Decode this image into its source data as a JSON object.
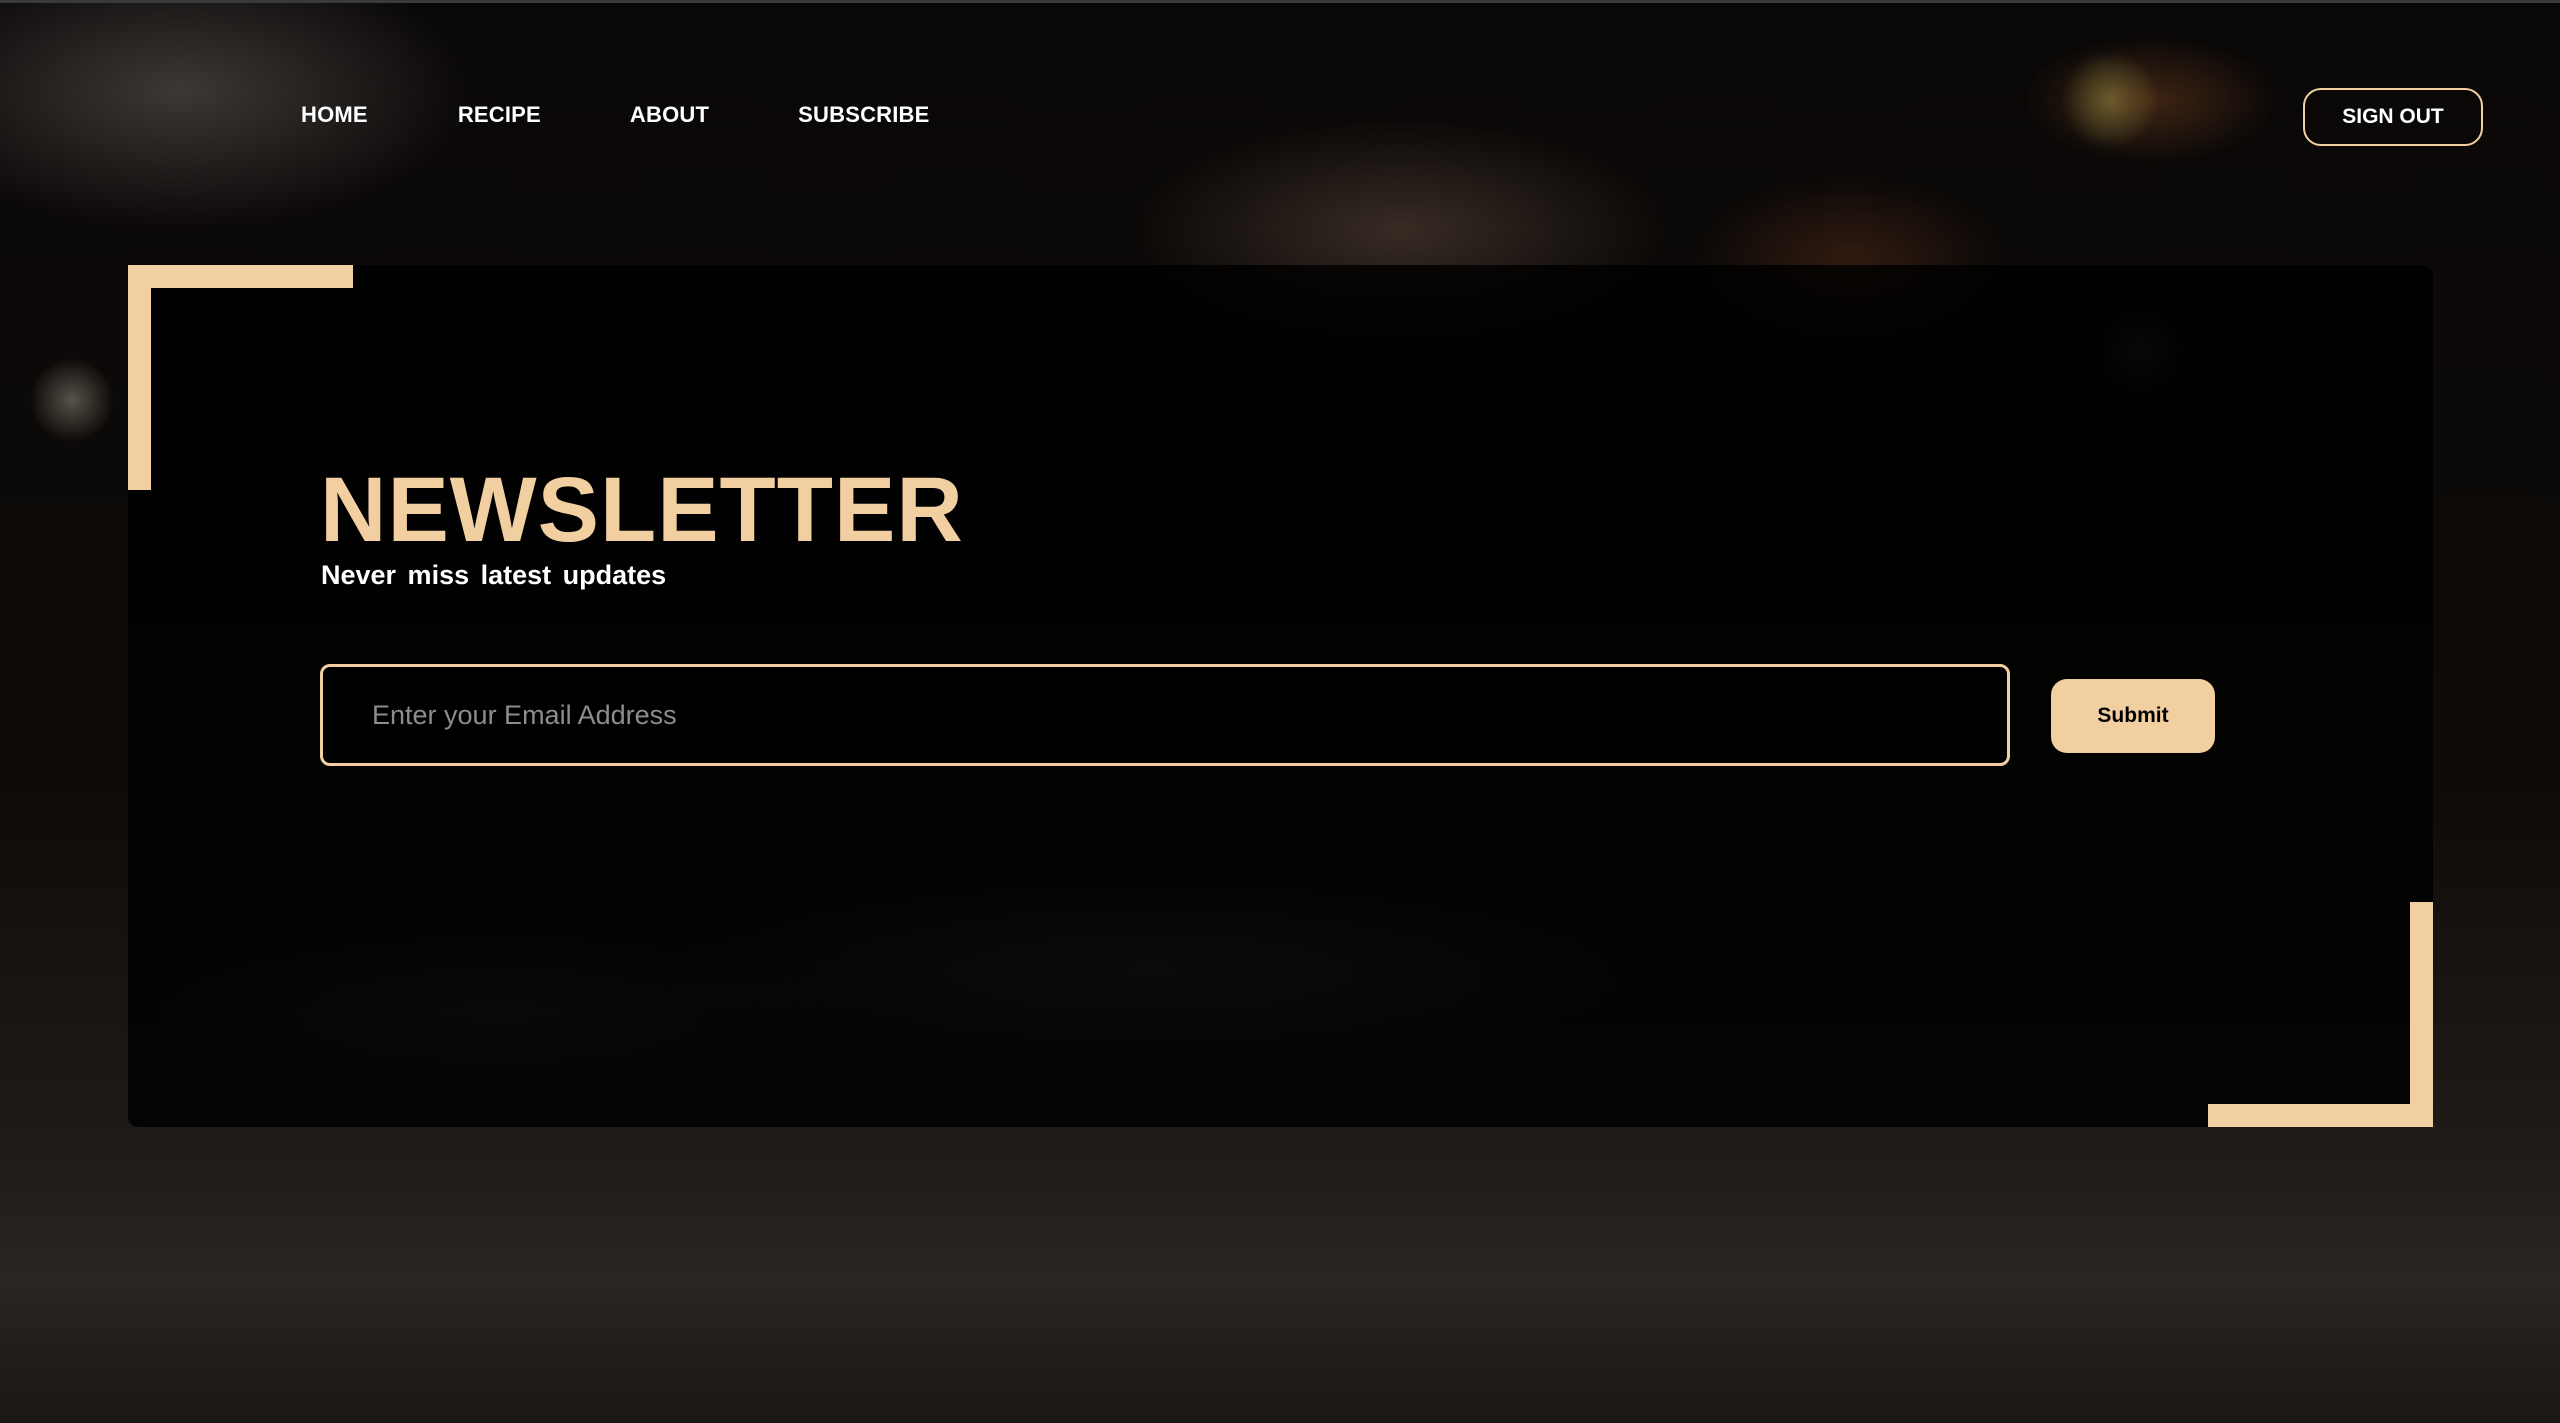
{
  "nav": {
    "items": [
      {
        "label": "HOME"
      },
      {
        "label": "RECIPE"
      },
      {
        "label": "ABOUT"
      },
      {
        "label": "SUBSCRIBE"
      }
    ],
    "signout_label": "SIGN OUT"
  },
  "newsletter": {
    "title": "NEWSLETTER",
    "subtitle": "Never miss latest updates",
    "email_placeholder": "Enter your Email Address",
    "email_value": "",
    "submit_label": "Submit"
  },
  "colors": {
    "accent": "#f2cfa0",
    "panel": "#000000",
    "text": "#ffffff"
  }
}
